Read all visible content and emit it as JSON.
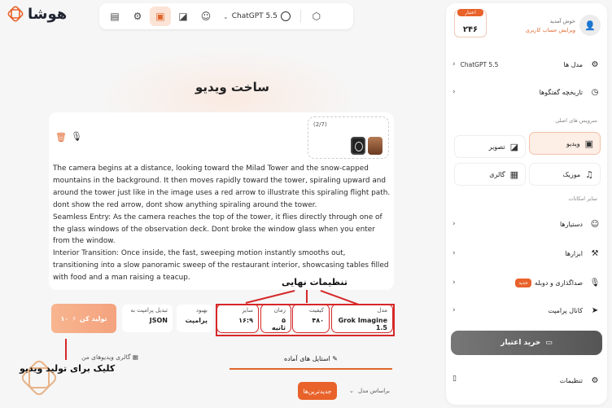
{
  "app": {
    "logo_text": "هوشا"
  },
  "topbar": {
    "icons": [
      "files-icon",
      "tools-icon",
      "video-icon",
      "image-icon",
      "robot-icon"
    ],
    "model_label": "ChatGPT 5.5",
    "extra_icon": "shield-icon"
  },
  "main": {
    "title": "ساخت ویدیو",
    "attachments": {
      "count": "(2/7)"
    },
    "prompt": "The camera begins at a distance, looking toward the Milad Tower and the snow-capped mountains in the background. It then moves rapidly toward the tower, spiraling upward and around the tower just like in the image uses a red arrow to illustrate this spiraling flight path. dont show the red arrow, dont show anything spiraling around the tower.\nSeamless Entry: As the camera reaches the top of the tower, it flies directly through one of the glass windows of the observation deck. Dont broke the window glass when you enter from the window.\nInterior Transition: Once inside, the fast, sweeping motion instantly smooths out, transitioning into a slow panoramic sweep of the restaurant interior, showcasing tables filled with food and a man raising a teacup.",
    "generate_button": {
      "label": "تولید کن",
      "cost": "۱۰"
    },
    "options": {
      "json": {
        "label": "تبدیل پرامپت به",
        "value": "JSON"
      },
      "improve": {
        "label": "بهبود",
        "value": "پرامپت"
      },
      "size": {
        "label": "سایز",
        "value": "۱۶:۹"
      },
      "duration": {
        "label": "زمان",
        "value": "۵ ثانیه"
      },
      "quality": {
        "label": "کیفیت",
        "value": "۴۸۰"
      },
      "model": {
        "label": "مدل",
        "value": "Grok Imagine 1.5"
      }
    },
    "annotations": {
      "final_settings": "تنظیمات نهایی",
      "click_to_generate": "کلیک برای تولید ویدیو"
    },
    "tabs": {
      "styles": "استایل های آماده",
      "gallery": "گالری ویدیوهای من"
    },
    "newest_button": "جدیدترین‌ها",
    "sort_select": "براساس مدل"
  },
  "sidebar": {
    "user": {
      "greeting": "خوش آمدید",
      "edit_link": "ویرایش حساب کاربری"
    },
    "credit": {
      "label": "اعتبار",
      "value": "۲۴۶"
    },
    "models_row": {
      "label": "مدل ها",
      "value": "ChatGPT 5.5"
    },
    "history_row": {
      "label": "تاریخچه گفتگوها"
    },
    "services_title": "سرویس های اصلی",
    "services": [
      "ویدیو",
      "تصویر",
      "موزیک",
      "گالری"
    ],
    "other_title": "سایر امکانات",
    "assistants": "دستیارها",
    "tools": "ابزارها",
    "voice": {
      "label": "صداگذاری و دوبله",
      "badge": "جدید"
    },
    "prompt_channel": "کانال پرامپت",
    "buy_button": "خرید اعتبار",
    "settings": "تنظیمات"
  },
  "colors": {
    "accent": "#e8622a",
    "annotation_red": "#d62828"
  }
}
